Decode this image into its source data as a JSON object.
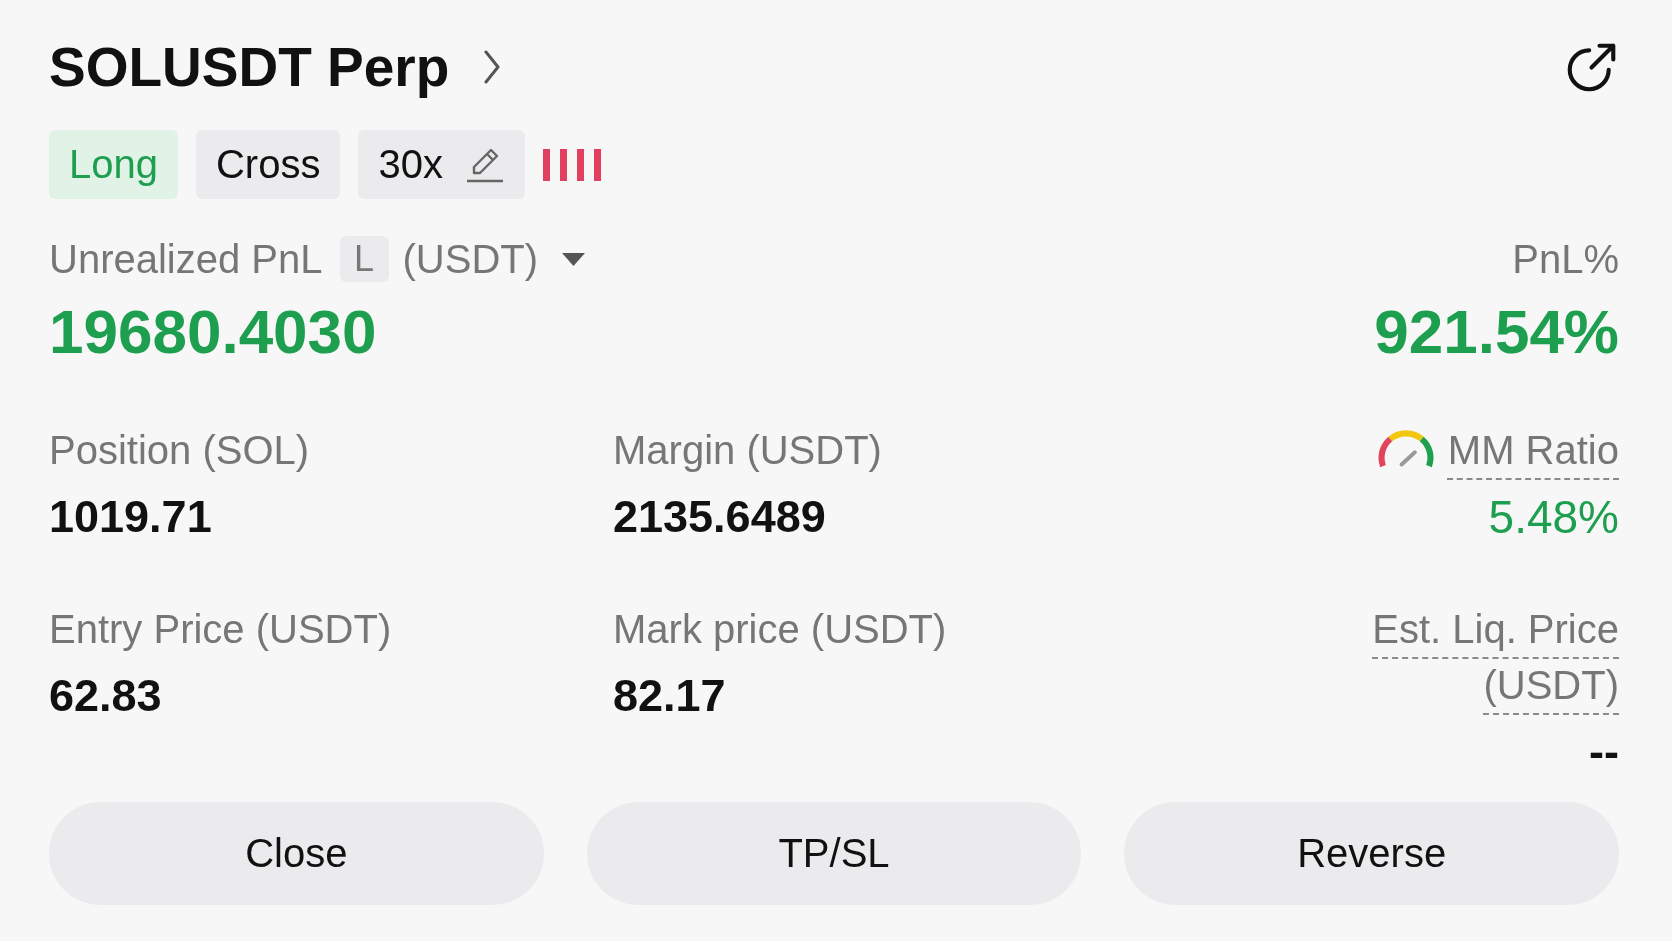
{
  "header": {
    "title": "SOLUSDT Perp"
  },
  "tags": [
    {
      "kind": "long",
      "label": "Long"
    },
    {
      "kind": "plain",
      "label": "Cross"
    },
    {
      "kind": "editable",
      "label": "30x"
    }
  ],
  "pnl": {
    "label": "Unrealized PnL",
    "tag": "L",
    "unit": "(USDT)",
    "value": "19680.4030",
    "percent_label": "PnL%",
    "percent_value": "921.54%",
    "positive": true
  },
  "stats": [
    {
      "label": "Position (SOL)",
      "value": "1019.71",
      "hint": false,
      "gauge": false,
      "positive": false
    },
    {
      "label": "Margin (USDT)",
      "value": "2135.6489",
      "hint": false,
      "gauge": false,
      "positive": false
    },
    {
      "label": "MM Ratio",
      "value": "5.48%",
      "hint": true,
      "gauge": true,
      "positive": true
    },
    {
      "label": "Entry Price (USDT)",
      "value": "62.83",
      "hint": false,
      "gauge": false,
      "positive": false
    },
    {
      "label": "Mark price (USDT)",
      "value": "82.17",
      "hint": false,
      "gauge": false,
      "positive": false
    },
    {
      "label": "Est. Liq. Price (USDT)",
      "value": "--",
      "hint": true,
      "gauge": false,
      "positive": false
    }
  ],
  "buttons": [
    {
      "label": "Close"
    },
    {
      "label": "TP/SL"
    },
    {
      "label": "Reverse"
    }
  ]
}
